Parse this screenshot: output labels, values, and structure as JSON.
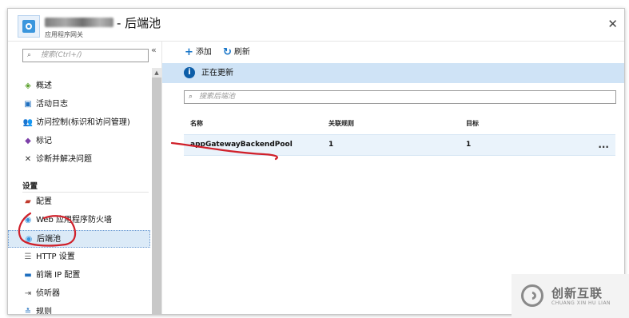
{
  "header": {
    "title": "- 后端池",
    "subtitle": "应用程序网关",
    "close_label": "✕"
  },
  "sidebar": {
    "search_placeholder": "搜索(Ctrl+/)",
    "collapse_label": "«",
    "items_top": [
      {
        "label": "概述",
        "icon": "overview-icon"
      },
      {
        "label": "活动日志",
        "icon": "activity-log-icon"
      },
      {
        "label": "访问控制(标识和访问管理)",
        "icon": "access-control-icon"
      },
      {
        "label": "标记",
        "icon": "tag-icon"
      },
      {
        "label": "诊断并解决问题",
        "icon": "diagnose-icon"
      }
    ],
    "section_label": "设置",
    "items_settings": [
      {
        "label": "配置",
        "icon": "configuration-icon"
      },
      {
        "label": "Web 应用程序防火墙",
        "icon": "firewall-icon"
      },
      {
        "label": "后端池",
        "icon": "backend-pool-icon",
        "active": true
      },
      {
        "label": "HTTP 设置",
        "icon": "http-settings-icon"
      },
      {
        "label": "前端 IP 配置",
        "icon": "frontend-ip-icon"
      },
      {
        "label": "侦听器",
        "icon": "listener-icon"
      },
      {
        "label": "规则",
        "icon": "rules-icon"
      }
    ]
  },
  "toolbar": {
    "add_label": "添加",
    "refresh_label": "刷新"
  },
  "banner": {
    "text": "正在更新"
  },
  "filter": {
    "placeholder": "搜索后端池"
  },
  "table": {
    "columns": [
      "名称",
      "关联规则",
      "目标"
    ],
    "rows": [
      {
        "name": "appGatewayBackendPool",
        "rules": "1",
        "targets": "1",
        "more": "..."
      }
    ]
  },
  "watermark": {
    "cn": "创新互联",
    "en": "CHUANG XIN HU LIAN"
  },
  "colors": {
    "accent": "#1473c7",
    "banner_bg": "#cfe3f6",
    "active_bg": "#dbeaf7",
    "annotation": "#d0202a"
  }
}
